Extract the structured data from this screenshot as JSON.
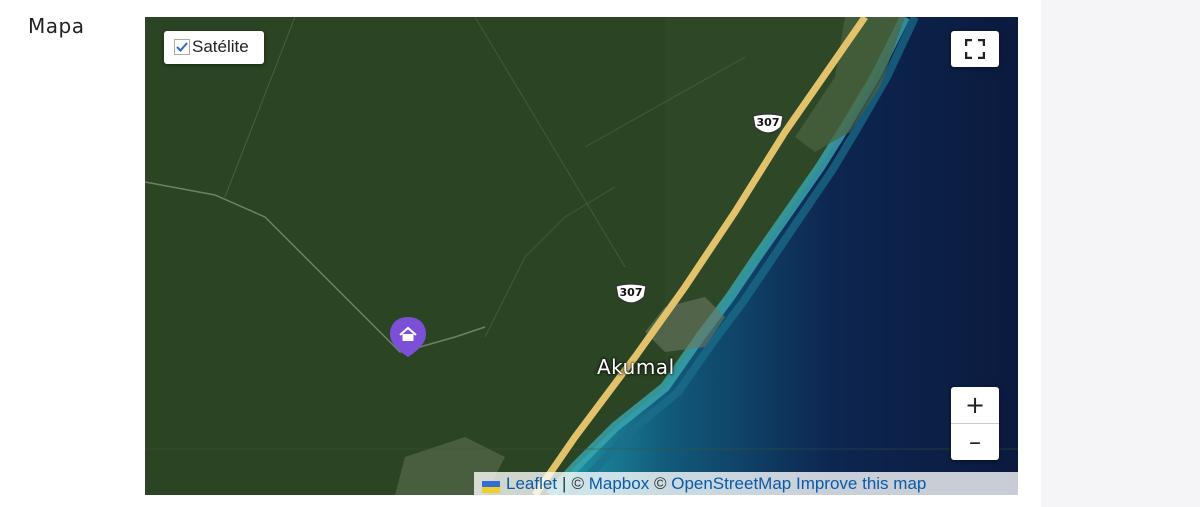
{
  "section": {
    "title": "Mapa"
  },
  "map": {
    "layer_toggle": {
      "label": "Satélite",
      "checked": true
    },
    "place_label": "Akumal",
    "road_shields": [
      "307",
      "307"
    ],
    "zoom": {
      "in_label": "+",
      "out_label": "–"
    },
    "marker_icon": "home-icon",
    "attribution": {
      "leaflet": "Leaflet",
      "separator": "|",
      "copy1": "©",
      "mapbox": "Mapbox",
      "copy2": "©",
      "osm": "OpenStreetMap",
      "improve": "Improve this map"
    },
    "colors": {
      "forest": "#2f4a26",
      "highway": "#e2c26a",
      "ocean_deep": "#0d1f4a",
      "reef": "#1e8fa0",
      "marker": "#7b4fd6",
      "link": "#0a5aa8"
    }
  }
}
